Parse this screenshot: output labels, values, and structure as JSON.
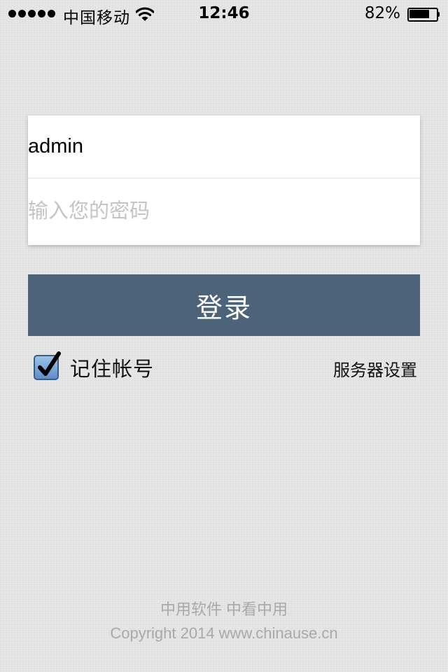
{
  "status_bar": {
    "carrier": "中国移动",
    "time": "12:46",
    "battery_percent": "82%",
    "battery_level": 0.82,
    "signal_bars": 5,
    "icons": [
      "signal-dots-icon",
      "wifi-icon",
      "battery-icon"
    ]
  },
  "login": {
    "username_value": "admin",
    "password_placeholder": "输入您的密码",
    "submit_label": "登录"
  },
  "options": {
    "remember_label": "记住帐号",
    "remember_checked": true,
    "server_settings_label": "服务器设置"
  },
  "footer": {
    "slogan": "中用软件 中看中用",
    "copyright": "Copyright 2014 www.chinause.cn"
  },
  "colors": {
    "background": "#e3e3e3",
    "button": "#4c6379",
    "placeholder": "#c4c4c4",
    "footer_text": "#a9a9a9"
  }
}
